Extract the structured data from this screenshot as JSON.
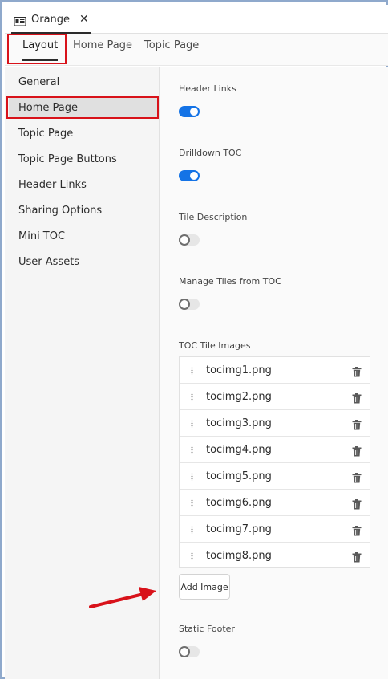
{
  "window": {
    "tab_title": "Orange",
    "tab_icon": "panel-icon",
    "close_glyph": "✕"
  },
  "top_tabs": [
    {
      "label": "Layout",
      "active": true
    },
    {
      "label": "Home Page",
      "active": false
    },
    {
      "label": "Topic Page",
      "active": false
    }
  ],
  "sidebar": {
    "items": [
      {
        "label": "General"
      },
      {
        "label": "Home Page",
        "selected": true
      },
      {
        "label": "Topic Page"
      },
      {
        "label": "Topic Page Buttons"
      },
      {
        "label": "Header Links"
      },
      {
        "label": "Sharing Options"
      },
      {
        "label": "Mini TOC"
      },
      {
        "label": "User Assets"
      }
    ]
  },
  "settings": {
    "header_links": {
      "label": "Header Links",
      "on": true
    },
    "drilldown_toc": {
      "label": "Drilldown TOC",
      "on": true
    },
    "tile_description": {
      "label": "Tile Description",
      "on": false
    },
    "manage_tiles": {
      "label": "Manage Tiles from TOC",
      "on": false
    },
    "toc_tile_images": {
      "label": "TOC Tile Images",
      "images": [
        "tocimg1.png",
        "tocimg2.png",
        "tocimg3.png",
        "tocimg4.png",
        "tocimg5.png",
        "tocimg6.png",
        "tocimg7.png",
        "tocimg8.png"
      ]
    },
    "add_image_label": "Add Image",
    "static_footer": {
      "label": "Static Footer",
      "on": false
    }
  },
  "colors": {
    "accent": "#1473e6",
    "highlight_box": "#d8121a",
    "arrow": "#d8121a"
  }
}
